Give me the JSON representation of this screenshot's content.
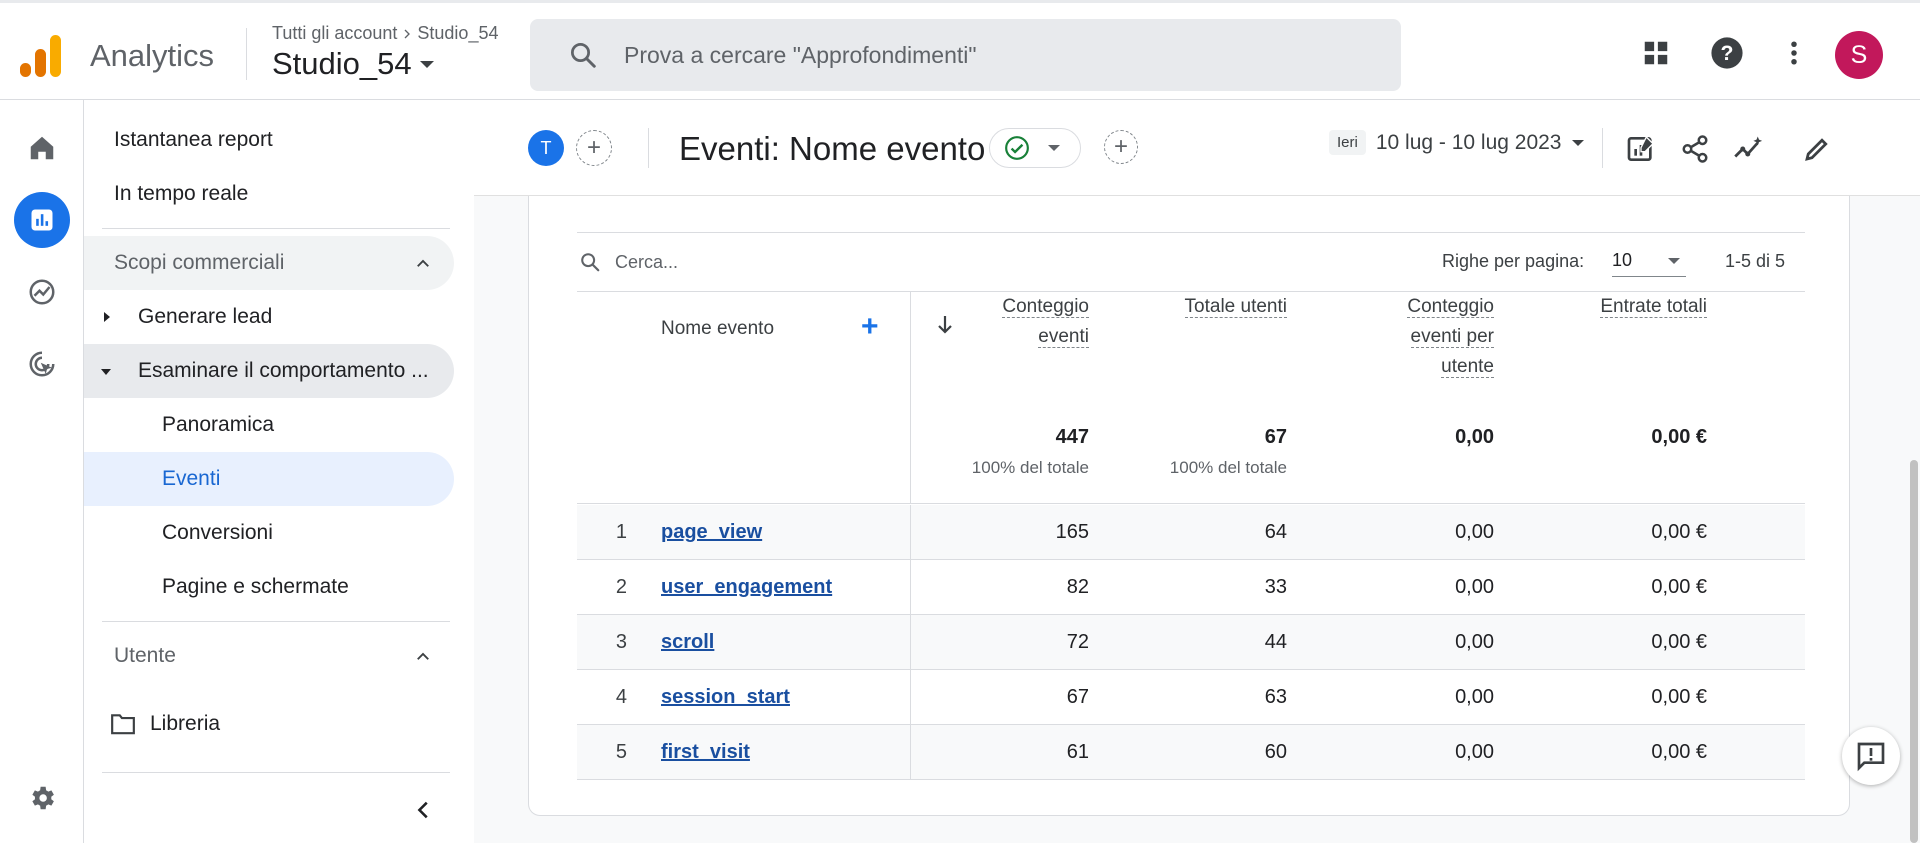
{
  "app": {
    "name": "Analytics",
    "account_crumb": "Tutti gli account",
    "property_crumb": "Studio_54",
    "property": "Studio_54",
    "avatar_letter": "S",
    "colors": {
      "accent": "#1a73e8",
      "avatar": "#c2185b",
      "logo": [
        "#f9ab00",
        "#e37400",
        "#e37400"
      ]
    }
  },
  "search": {
    "placeholder": "Prova a cercare \"Approfondimenti\""
  },
  "top_icons": [
    "apps-grid-icon",
    "help-icon",
    "more-vert-icon"
  ],
  "rail": [
    "home-icon",
    "reports-icon",
    "explore-icon",
    "advertising-icon",
    "settings-icon"
  ],
  "sidenav": {
    "snapshot": "Istantanea report",
    "realtime": "In tempo reale",
    "section_business": "Scopi commerciali",
    "group_leads": "Generare lead",
    "group_behavior": "Esaminare il comportamento ...",
    "items": [
      {
        "label": "Panoramica",
        "active": false
      },
      {
        "label": "Eventi",
        "active": true
      },
      {
        "label": "Conversioni",
        "active": false
      },
      {
        "label": "Pagine e schermate",
        "active": false
      }
    ],
    "section_user": "Utente",
    "library": "Libreria"
  },
  "toolbar": {
    "comparison_chip": "T",
    "report_title": "Eventi: Nome evento",
    "date_badge": "Ieri",
    "date_range": "10 lug - 10 lug 2023"
  },
  "table": {
    "search_placeholder": "Cerca...",
    "rows_per_page_label": "Righe per pagina:",
    "rows_per_page": "10",
    "pagination": "1-5 di 5",
    "dimension_header": "Nome evento",
    "metric_headers": [
      [
        "Conteggio",
        "eventi"
      ],
      [
        "Totale utenti"
      ],
      [
        "Conteggio",
        "eventi per",
        "utente"
      ],
      [
        "Entrate totali"
      ]
    ],
    "totals": [
      "447",
      "67",
      "0,00",
      "0,00 €"
    ],
    "totals_sub": [
      "100% del totale",
      "100% del totale"
    ],
    "rows": [
      {
        "idx": "1",
        "event": "page_view",
        "values": [
          "165",
          "64",
          "0,00",
          "0,00 €"
        ]
      },
      {
        "idx": "2",
        "event": "user_engagement",
        "values": [
          "82",
          "33",
          "0,00",
          "0,00 €"
        ]
      },
      {
        "idx": "3",
        "event": "scroll",
        "values": [
          "72",
          "44",
          "0,00",
          "0,00 €"
        ]
      },
      {
        "idx": "4",
        "event": "session_start",
        "values": [
          "67",
          "63",
          "0,00",
          "0,00 €"
        ]
      },
      {
        "idx": "5",
        "event": "first_visit",
        "values": [
          "61",
          "60",
          "0,00",
          "0,00 €"
        ]
      }
    ]
  }
}
